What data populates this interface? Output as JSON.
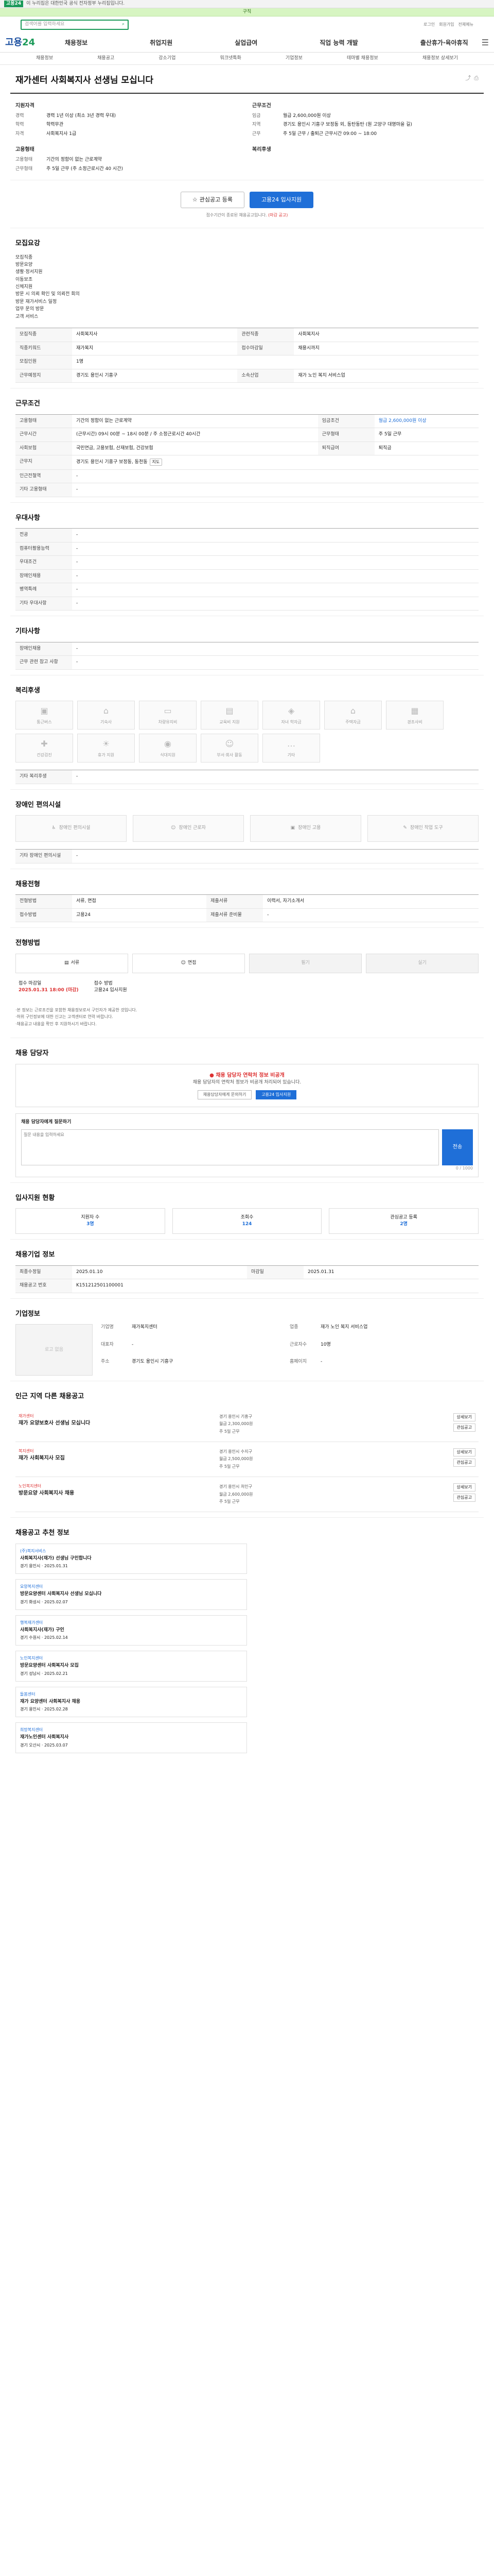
{
  "topbar": {
    "logo": "고용24",
    "text": "이 누리집은 대한민국 공식 전자정부 누리집입니다."
  },
  "greenbar": "구직",
  "search": {
    "placeholder": "검색어를 입력하세요",
    "util": [
      "로그인",
      "회원가입",
      "전체메뉴"
    ]
  },
  "gnb": {
    "brand_a": "고용",
    "brand_b": "24",
    "menu": [
      "채용정보",
      "취업지원",
      "실업급여",
      "직업 능력 개발",
      "출산휴가·육아휴직"
    ]
  },
  "lnb": [
    "채용정보",
    "채용공고",
    "강소기업",
    "워크넷특화",
    "기업정보",
    "테마별 채용정보",
    "채용정보 상세보기"
  ],
  "title": "재가센터 사회복지사 선생님 모십니다",
  "summary": {
    "left_title": "지원자격",
    "left": [
      {
        "k": "경력",
        "v": "경력 1년 이상 (최소 3년 경력 우대)"
      },
      {
        "k": "학력",
        "v": "학력무관"
      },
      {
        "k": "자격",
        "v": "사회복지사 1급"
      }
    ],
    "right_title": "근무조건",
    "right": [
      {
        "k": "임금",
        "v": "월급 2,600,000원 이상"
      },
      {
        "k": "지역",
        "v": "경기도 용인시 기흥구 보정동 외, 동탄동탄 (원 고양구 대명마을 길)"
      },
      {
        "k": "근무",
        "v": "주 5일 근무 / 출퇴근 근무시간 09:00 ~ 18:00"
      }
    ],
    "left2_title": "고용형태",
    "left2": [
      {
        "k": "고용형태",
        "v": "기간의 정함이 없는 근로계약"
      },
      {
        "k": "근무형태",
        "v": "주 5일 근무 (주 소정근로시간 40 시간)"
      }
    ],
    "right2_title": "복리후생",
    "right2": [
      {
        "k": "",
        "v": ""
      }
    ]
  },
  "actions": {
    "save": "관심공고 등록",
    "apply": "고용24 입사지원"
  },
  "notice": {
    "text": "접수기간이 종료된 채용공고입니다.",
    "red": "(마감 공고)"
  },
  "s_job": {
    "title": "모집요강",
    "desc": [
      "모집직종",
      "",
      "방문요양",
      "",
      "생활·정서지원",
      "이동보조",
      "신체지원",
      "방문 시 의뢰 확인 및 의뢰전 회의",
      "방문 재가서비스 일정",
      "업무 문의 방문",
      "고객 서비스"
    ],
    "rows": [
      {
        "k": "모집직종",
        "v": "사회복지사"
      },
      {
        "k": "관련직종",
        "v": "사회복지사"
      },
      {
        "k": "직종키워드",
        "v": "재가복지"
      },
      {
        "k": "접수마감일",
        "v": "채용시까지"
      },
      {
        "k": "모집인원",
        "v": "1명"
      },
      {
        "k": "근무예정지",
        "v": "경기도 용인시 기흥구"
      },
      {
        "k": "소속산업",
        "v": "재가 노인 복지 서비스업"
      }
    ]
  },
  "s_cond": {
    "title": "근무조건",
    "rows": [
      {
        "k": "고용형태",
        "v": "기간의 정함이 없는 근로계약"
      },
      {
        "k": "임금조건",
        "v": "월급 2,600,000원 이상"
      },
      {
        "k": "근무시간",
        "v": "(근무시간) 09시 00분 ~ 18시 00분 / 주 소정근로시간 40시간"
      },
      {
        "k": "근무형태",
        "v": "주 5일 근무"
      },
      {
        "k": "사회보험",
        "v": "국민연금, 고용보험, 산재보험, 건강보험"
      },
      {
        "k": "퇴직급여",
        "v": "퇴직금"
      },
      {
        "k": "근무지",
        "v": "경기도 용인시 기흥구 보정동, 동천동"
      },
      {
        "k": "인근전철역",
        "v": "-"
      },
      {
        "k": "기타 고용형태",
        "v": "-"
      }
    ]
  },
  "s_qual": {
    "title": "우대사항",
    "rows": [
      {
        "k": "전공",
        "v": "-"
      },
      {
        "k": "컴퓨터활용능력",
        "v": "-"
      },
      {
        "k": "우대조건",
        "v": "-"
      },
      {
        "k": "장애인채용",
        "v": "-"
      },
      {
        "k": "병역특례",
        "v": "-"
      },
      {
        "k": "기타 우대사항",
        "v": "-"
      }
    ]
  },
  "s_etc": {
    "title": "기타사항",
    "rows": [
      {
        "k": "장애인채용",
        "v": "-"
      },
      {
        "k": "근무 관련 참고 사항",
        "v": "-"
      }
    ]
  },
  "s_welfare": {
    "title": "복리후생",
    "cards": [
      "통근버스",
      "기숙사",
      "차량유지비",
      "교육비 지원",
      "자녀 학자금",
      "주택자금",
      "경조사비",
      "건강검진",
      "휴가 지원",
      "식대지원",
      "부서·회사 활동",
      "기타"
    ],
    "etc": "기타 복리후생"
  },
  "s_disab": {
    "title": "장애인 편의시설",
    "cards": [
      "장애인 편의시설",
      "장애인 근로자",
      "장애인 고용",
      "장애인 작업 도구"
    ],
    "etc": "기타 장애인 편의시설"
  },
  "s_proc": {
    "title": "채용전형",
    "rows": [
      {
        "k": "전형방법",
        "v": "서류, 면접"
      },
      {
        "k": "제출서류",
        "v": "이력서, 자기소개서"
      },
      {
        "k": "접수방법",
        "v": "고용24"
      },
      {
        "k": "제출서류 준비물",
        "v": "-"
      }
    ]
  },
  "s_method": {
    "title": "전형방법",
    "items": [
      "서류",
      "면접",
      "필기",
      "실기"
    ],
    "deadline_k": "접수 마감일",
    "deadline_v": "2025.01.31 18:00",
    "deadline_note": "(마감)",
    "method_k": "접수 방법",
    "method_v": "고용24 입사지원"
  },
  "s_warn": [
    "·본 정보는 근로조건을 포함한 채용정보로서 구인자가 제공한 것입니다.",
    "·허위 구인정보에 대한 신고는 고객센터로 연락 바랍니다.",
    "·채용공고 내용을 확인 후 지원하시기 바랍니다."
  ],
  "s_contact": {
    "title": "채용 담당자",
    "headline": "채용 담당자 연락처 정보 비공개",
    "text": "채용 담당자의 연락처 정보가 비공개 처리되어 있습니다.",
    "btn1": "채용담당자에게 문의하기",
    "btn2": "고용24 입사지원"
  },
  "s_ask": {
    "title": "채용 담당자에게 질문하기",
    "placeholder": "질문 내용을 입력하세요",
    "send": "전송",
    "count": "0 / 1000"
  },
  "s_stats": {
    "title": "입사지원 현황",
    "items": [
      {
        "k": "지원자 수",
        "v": "3명"
      },
      {
        "k": "조회수",
        "v": "124"
      },
      {
        "k": "관심공고 등록",
        "v": "2명"
      }
    ]
  },
  "s_info": {
    "title": "채용기업 정보",
    "rows": [
      {
        "k": "최종수정일",
        "v": "2025.01.10"
      },
      {
        "k": "마감일",
        "v": "2025.01.31"
      },
      {
        "k": "채용공고 번호",
        "v": "K151212501100001"
      }
    ]
  },
  "s_company": {
    "title": "기업정보",
    "logo": "로고 없음",
    "info": [
      {
        "k": "기업명",
        "v": "재가복지센터"
      },
      {
        "k": "업종",
        "v": "재가 노인 복지 서비스업"
      },
      {
        "k": "대표자",
        "v": "-"
      },
      {
        "k": "근로자수",
        "v": "10명"
      },
      {
        "k": "주소",
        "v": "경기도 용인시 기흥구"
      },
      {
        "k": "홈페이지",
        "v": "-"
      }
    ]
  },
  "s_other": {
    "title": "인근 지역 다른 채용공고",
    "jobs": [
      {
        "co": "재가센터",
        "t": "재가 요양보호사 선생님 모십니다",
        "m": [
          "경기 용인시 기흥구",
          "월급 2,300,000원",
          "주 5일 근무"
        ],
        "r": [
          "상세보기",
          "관심공고"
        ]
      },
      {
        "co": "복지센터",
        "t": "재가 사회복지사 모집",
        "m": [
          "경기 용인시 수지구",
          "월급 2,500,000원",
          "주 5일 근무"
        ],
        "r": [
          "상세보기",
          "관심공고"
        ]
      },
      {
        "co": "노인복지센터",
        "t": "방문요양 사회복지사 채용",
        "m": [
          "경기 용인시 처인구",
          "월급 2,600,000원",
          "주 5일 근무"
        ],
        "r": [
          "상세보기",
          "관심공고"
        ]
      }
    ]
  },
  "s_rec": {
    "title": "채용공고 추천 정보",
    "items": [
      {
        "co": "(주)복지서비스",
        "t": "사회복지사(재가) 선생님 구인합니다",
        "d": "경기 용인시 · 2025.01.31"
      },
      {
        "co": "요양복지센터",
        "t": "방문요양센터 사회복지사 선생님 모십니다",
        "d": "경기 화성시 · 2025.02.07"
      },
      {
        "co": "행복재가센터",
        "t": "사회복지사(재가) 구인",
        "d": "경기 수원시 · 2025.02.14"
      },
      {
        "co": "노인복지센터",
        "t": "방문요양센터 사회복지사 모집",
        "d": "경기 성남시 · 2025.02.21"
      },
      {
        "co": "돌봄센터",
        "t": "재가 요양센터 사회복지사 채용",
        "d": "경기 용인시 · 2025.02.28"
      },
      {
        "co": "희망복지센터",
        "t": "재가노인센터 사회복지사",
        "d": "경기 오산시 · 2025.03.07"
      }
    ]
  }
}
